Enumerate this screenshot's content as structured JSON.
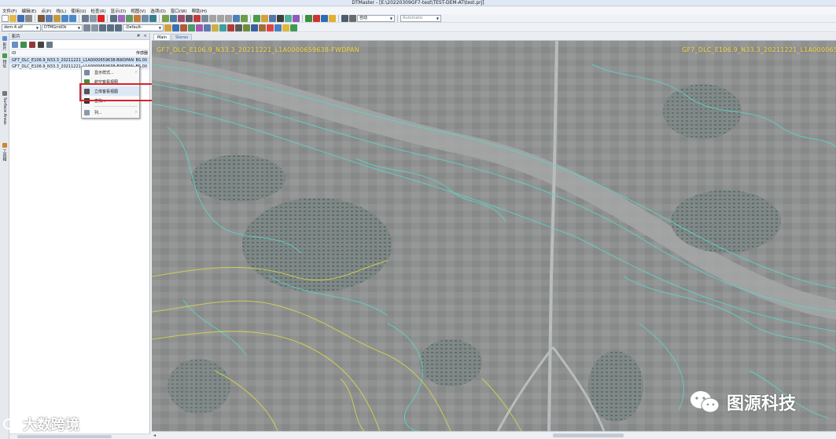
{
  "window": {
    "title": "DTMaster - [E:\\20220309GF7-test\\TEST-DEM-AT\\test.prj]"
  },
  "menu": [
    "文件(F)",
    "编辑(E)",
    "点(P)",
    "线(L)",
    "使用(U)",
    "检查(R)",
    "显示(D)",
    "视图(V)",
    "选项(O)",
    "窗口(W)",
    "帮助(H)"
  ],
  "toolbar": {
    "dem_combo": "dem-4.alf",
    "grid_combo": "DTMGridOk",
    "default_combo": "-Default-",
    "zoom_combo": "自动",
    "mode_combo": "Automatic"
  },
  "side_tabs": [
    "影片",
    "特征",
    "Surface Areas",
    "工具箱"
  ],
  "panel": {
    "title": "影片",
    "pin": "#",
    "close": "×",
    "columns": {
      "id": "ID",
      "value": "传感器"
    },
    "rows": [
      {
        "id": "GF7_DLC_E106.9_N33.3_20211221_L1A0000659638-BWDPAN",
        "value": "BS.00"
      },
      {
        "id": "GF7_DLC_E106.9_N33.3_20211221_L1A0000659638-FWDPAN",
        "value": "BS.00"
      }
    ]
  },
  "context_menu": {
    "items": [
      {
        "label": "显示样式...",
        "has_sub": true
      },
      {
        "label": "航空客看视图",
        "has_sub": false
      },
      {
        "label": "立体客看视图",
        "has_sub": false
      },
      {
        "label": "查找...",
        "has_sub": false
      },
      {
        "label": "列...",
        "has_sub": true
      }
    ]
  },
  "view_tabs": [
    "Main",
    "Stereo"
  ],
  "map": {
    "label_left": "GF7_DLC_E106.9_N33.3_20211221_L1A0000659638-FWDPAN",
    "label_right": "GF7_DLC_E106.9_N33.3_20211221_L1A000065"
  },
  "watermark": {
    "left": "大数跨境",
    "right": "图源科技"
  },
  "colors": {
    "contour_cyan": "#5fd3c4",
    "contour_yellow": "#d9d84a",
    "label_yellow": "#f2d33a",
    "highlight_red": "#d8232a"
  }
}
